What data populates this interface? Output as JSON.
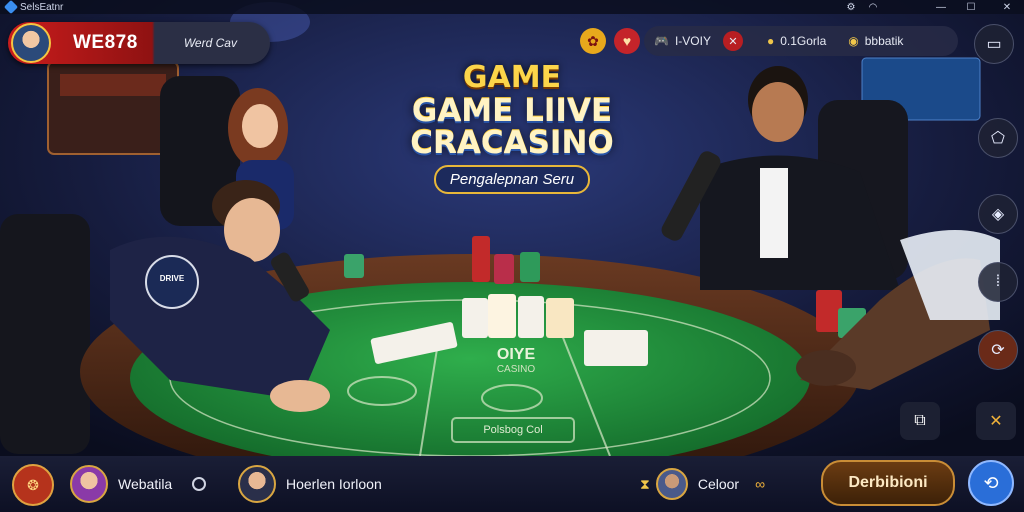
{
  "titlebar": {
    "app_title": "SelsEatnr",
    "controls": [
      "settings-icon",
      "wifi-icon",
      "minimize-icon",
      "maximize-icon",
      "close-icon"
    ]
  },
  "brand": {
    "name": "WE878",
    "subtitle": "Werd Cav"
  },
  "stats": {
    "item1": "I-VOIY",
    "item2": "0.1Gorla",
    "item3": "bbbatik"
  },
  "logo": {
    "line1": "GAME",
    "line2": "GAME LIIVE",
    "line3": "CRACASINO",
    "tagline": "Pengalepnan Seru"
  },
  "table": {
    "felt_text1": "OIYE",
    "felt_text2": "CASINO",
    "felt_box": "Polsbog Col",
    "player_badge": "DRIVE"
  },
  "bottom": {
    "player1": "Webatila",
    "player2": "Hoerlen Iorloon",
    "player3": "Celoor",
    "cta": "Derbibioni"
  },
  "colors": {
    "accent_red": "#c91c1c",
    "felt_green": "#1f8a3a",
    "gold": "#e8b739",
    "panel": "#2b2f45"
  }
}
